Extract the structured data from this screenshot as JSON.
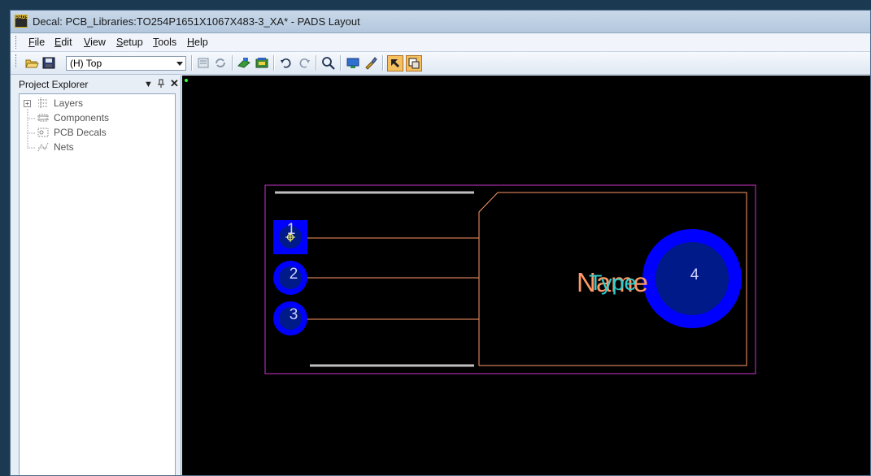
{
  "window": {
    "title": "Decal: PCB_Libraries:TO254P1651X1067X483-3_XA* - PADS Layout",
    "icon_text": "PADS"
  },
  "menu": {
    "items": [
      {
        "label": "File",
        "mnemonic": "F",
        "rest": "ile"
      },
      {
        "label": "Edit",
        "mnemonic": "E",
        "rest": "dit"
      },
      {
        "label": "View",
        "mnemonic": "V",
        "rest": "iew"
      },
      {
        "label": "Setup",
        "mnemonic": "S",
        "rest": "etup"
      },
      {
        "label": "Tools",
        "mnemonic": "T",
        "rest": "ools"
      },
      {
        "label": "Help",
        "mnemonic": "H",
        "rest": "elp"
      }
    ]
  },
  "toolbar": {
    "layer_select": "(H) Top",
    "buttons": [
      "open-icon",
      "save-icon",
      "properties-icon",
      "refresh-icon",
      "wizard-icon",
      "decal-editor-icon",
      "undo-icon",
      "redo-icon",
      "zoom-icon",
      "display-icon",
      "paint-icon",
      "toggle-a-icon",
      "toggle-b-icon"
    ]
  },
  "explorer": {
    "title": "Project Explorer",
    "items": [
      {
        "label": "Layers",
        "expandable": true,
        "icon": "layers-icon"
      },
      {
        "label": "Components",
        "expandable": false,
        "icon": "components-icon"
      },
      {
        "label": "PCB Decals",
        "expandable": false,
        "icon": "pcb-decals-icon"
      },
      {
        "label": "Nets",
        "expandable": false,
        "icon": "nets-icon"
      }
    ]
  },
  "canvas": {
    "background": "#000000",
    "pads": [
      {
        "number": "1",
        "shape": "square"
      },
      {
        "number": "2",
        "shape": "round"
      },
      {
        "number": "3",
        "shape": "round"
      },
      {
        "number": "4",
        "shape": "round-large"
      }
    ],
    "labels": {
      "name_text": "Name",
      "type_text": "Type"
    },
    "colors": {
      "pad": "#0000ff",
      "pad_inner": "#001a8a",
      "outline": "#ff9966",
      "keepout": "#cc33cc",
      "silk": "#c0c0c0",
      "name": "#ff9966",
      "type": "#33cccc"
    }
  }
}
